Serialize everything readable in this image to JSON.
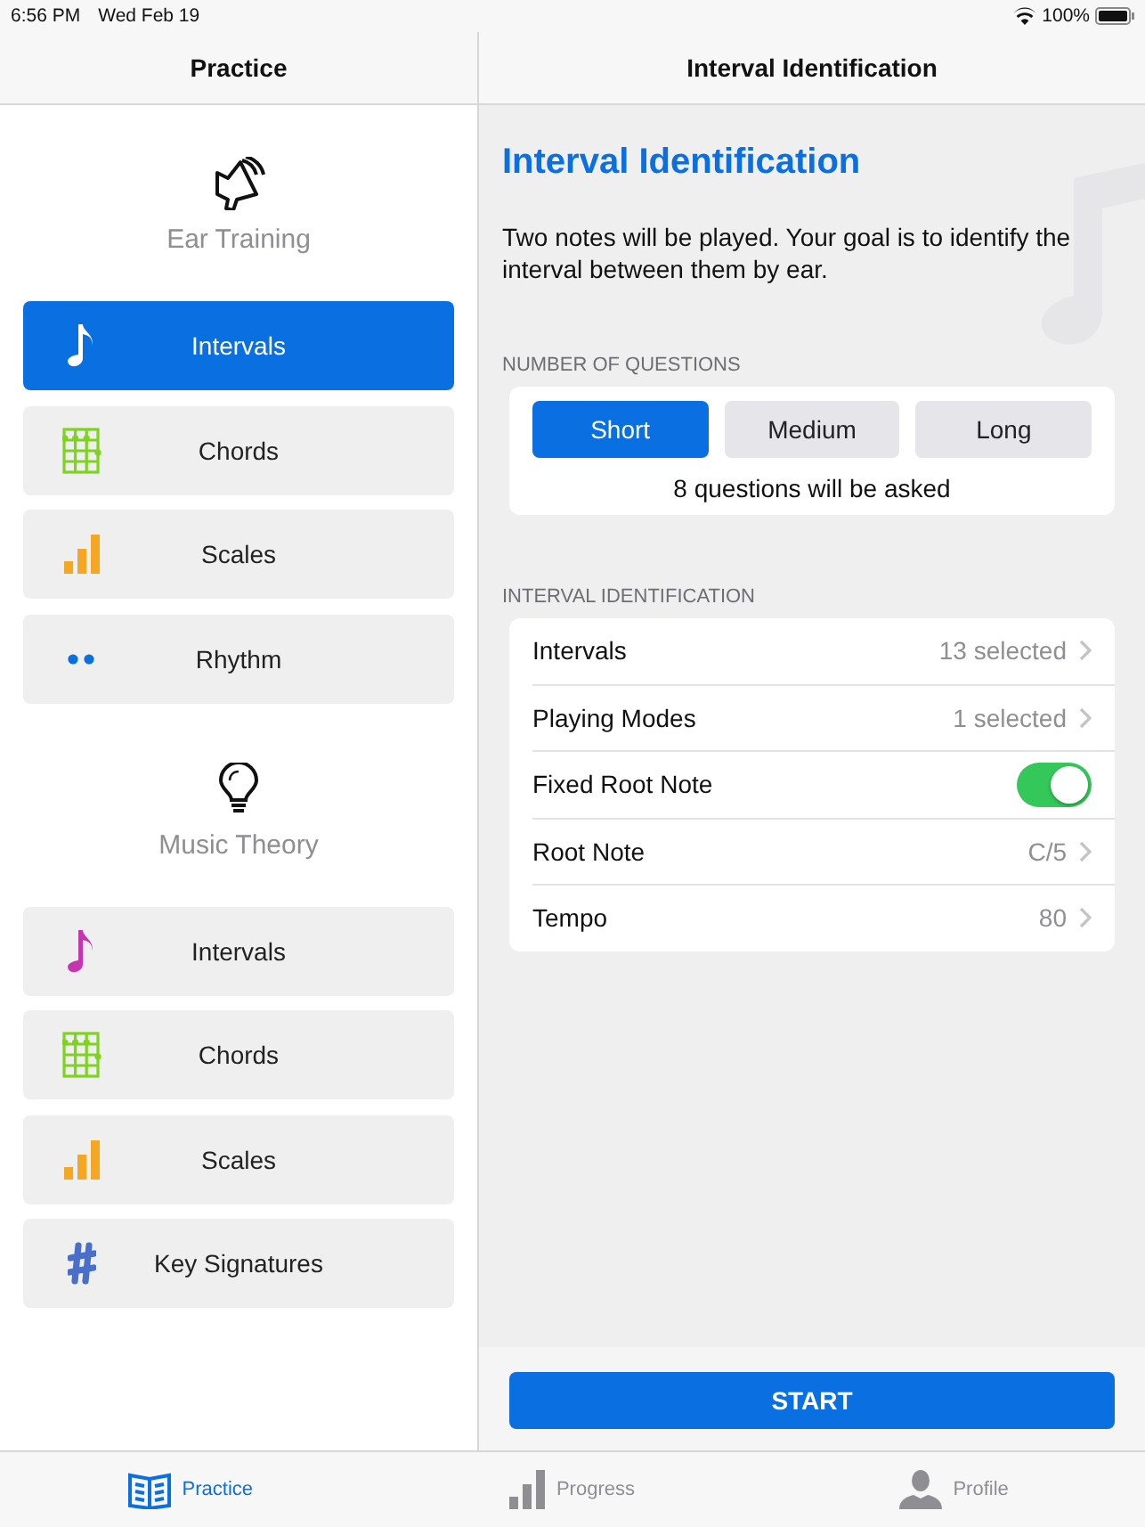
{
  "status_bar": {
    "time": "6:56 PM",
    "date": "Wed Feb 19",
    "battery": "100%"
  },
  "sidebar": {
    "title": "Practice",
    "sections": [
      {
        "kind": "speaker",
        "title": "Ear Training",
        "items": [
          {
            "label": "Intervals",
            "kind": "note",
            "selected": true
          },
          {
            "label": "Chords",
            "kind": "grid",
            "selected": false
          },
          {
            "label": "Scales",
            "kind": "bars",
            "selected": false
          },
          {
            "label": "Rhythm",
            "kind": "dots",
            "selected": false
          }
        ]
      },
      {
        "kind": "bulb",
        "title": "Music Theory",
        "items": [
          {
            "label": "Intervals",
            "kind": "note",
            "selected": false
          },
          {
            "label": "Chords",
            "kind": "grid",
            "selected": false
          },
          {
            "label": "Scales",
            "kind": "bars",
            "selected": false
          },
          {
            "label": "Key Signatures",
            "kind": "sharp",
            "selected": false
          }
        ]
      }
    ]
  },
  "detail": {
    "nav_title": "Interval Identification",
    "heading": "Interval Identification",
    "description": "Two notes will be played. Your goal is to identify the interval between them by ear.",
    "questions": {
      "caption": "NUMBER OF QUESTIONS",
      "options": [
        {
          "label": "Short",
          "selected": true
        },
        {
          "label": "Medium",
          "selected": false
        },
        {
          "label": "Long",
          "selected": false
        }
      ],
      "summary": "8 questions will be asked"
    },
    "settings": {
      "caption": "INTERVAL IDENTIFICATION",
      "rows": [
        {
          "kind": "link",
          "label": "Intervals",
          "value": "13 selected"
        },
        {
          "kind": "link",
          "label": "Playing Modes",
          "value": "1 selected"
        },
        {
          "kind": "toggle",
          "label": "Fixed Root Note",
          "on": true
        },
        {
          "kind": "link",
          "label": "Root Note",
          "value": "C/5"
        },
        {
          "kind": "link",
          "label": "Tempo",
          "value": "80"
        }
      ]
    },
    "start_button": "START"
  },
  "tab_bar": [
    {
      "label": "Practice",
      "kind": "book",
      "selected": true
    },
    {
      "label": "Progress",
      "kind": "bars",
      "selected": false
    },
    {
      "label": "Profile",
      "kind": "person",
      "selected": false
    }
  ]
}
